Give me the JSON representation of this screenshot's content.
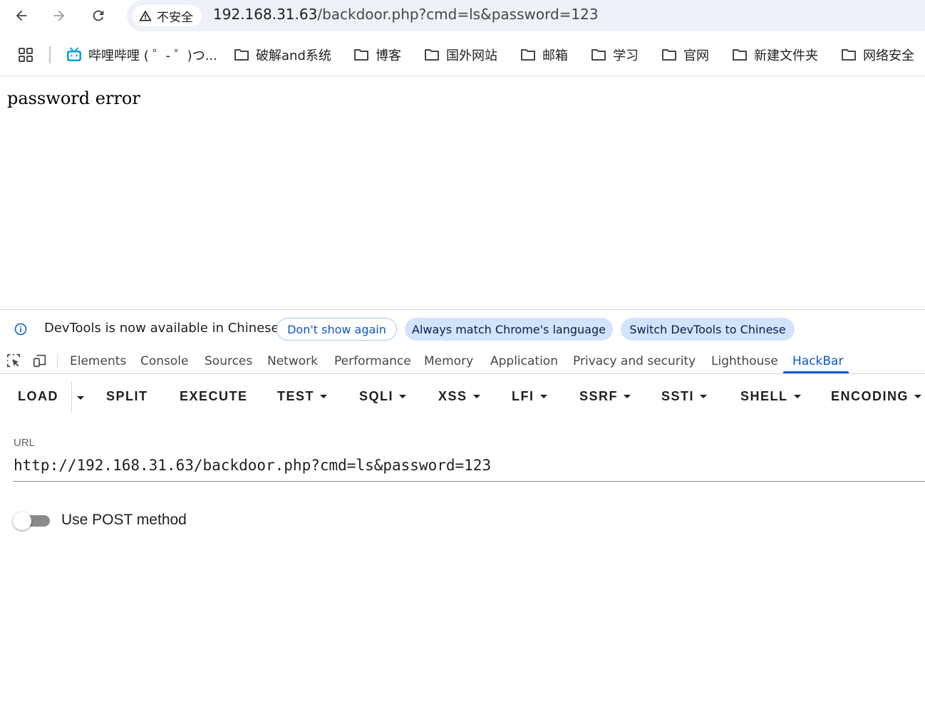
{
  "browser": {
    "security_label": "不安全",
    "url_host": "192.168.31.63",
    "url_path": "/backdoor.php?cmd=ls&password=123"
  },
  "bookmarks": [
    {
      "label": "哔哩哔哩 ( ゜- ゜)つ...",
      "icon": "bilibili-icon"
    },
    {
      "label": "破解and系统",
      "icon": "folder-icon"
    },
    {
      "label": "博客",
      "icon": "folder-icon"
    },
    {
      "label": "国外网站",
      "icon": "folder-icon"
    },
    {
      "label": "邮箱",
      "icon": "folder-icon"
    },
    {
      "label": "学习",
      "icon": "folder-icon"
    },
    {
      "label": "官网",
      "icon": "folder-icon"
    },
    {
      "label": "新建文件夹",
      "icon": "folder-icon"
    },
    {
      "label": "网络安全",
      "icon": "folder-icon"
    }
  ],
  "page": {
    "body_text": "password error"
  },
  "devtools": {
    "infobar": {
      "message": "DevTools is now available in Chinese",
      "dont_show": "Don't show again",
      "match_language": "Always match Chrome's language",
      "switch_language": "Switch DevTools to Chinese"
    },
    "tabs": [
      "Elements",
      "Console",
      "Sources",
      "Network",
      "Performance",
      "Memory",
      "Application",
      "Privacy and security",
      "Lighthouse",
      "HackBar"
    ],
    "active_tab": "HackBar"
  },
  "hackbar": {
    "buttons": {
      "load": "LOAD",
      "split": "SPLIT",
      "execute": "EXECUTE",
      "test": "TEST",
      "sqli": "SQLI",
      "xss": "XSS",
      "lfi": "LFI",
      "ssrf": "SSRF",
      "ssti": "SSTI",
      "shell": "SHELL",
      "encoding": "ENCODING"
    },
    "url_label": "URL",
    "url_value": "http://192.168.31.63/backdoor.php?cmd=ls&password=123",
    "post_label": "Use POST method",
    "post_enabled": false
  },
  "colors": {
    "accent": "#0b57d0",
    "pill_filled": "#d3e3fd",
    "omnibox": "#eef1f8"
  }
}
